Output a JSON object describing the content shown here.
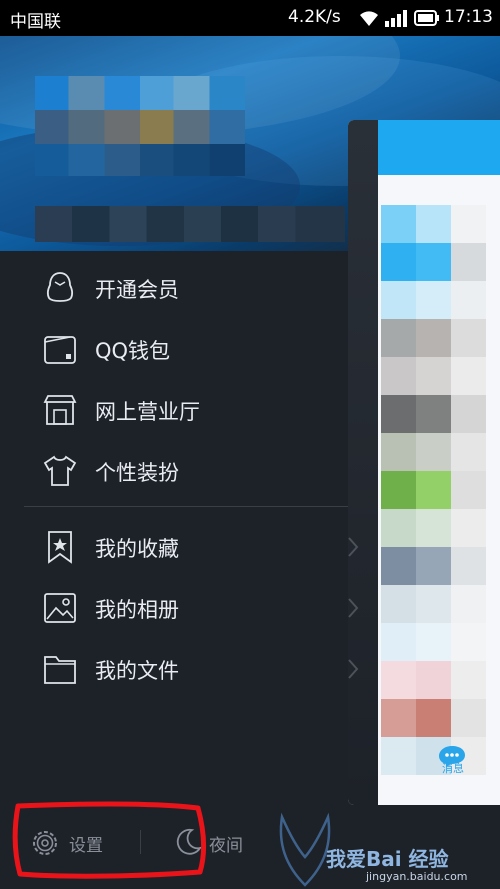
{
  "status_bar": {
    "carrier": "中国联",
    "net_speed": "4.2K/s",
    "time": "17:13"
  },
  "menu": [
    {
      "label": "开通会员",
      "icon": "penguin-icon"
    },
    {
      "label": "QQ钱包",
      "icon": "wallet-icon"
    },
    {
      "label": "网上营业厅",
      "icon": "store-icon"
    },
    {
      "label": "个性装扮",
      "icon": "tshirt-icon"
    },
    {
      "label": "我的收藏",
      "icon": "bookmark-star-icon"
    },
    {
      "label": "我的相册",
      "icon": "photo-album-icon"
    },
    {
      "label": "我的文件",
      "icon": "folder-icon"
    }
  ],
  "right_panel": {
    "tab_label": "消息"
  },
  "footer": {
    "settings_label": "设置",
    "night_label": "夜间"
  },
  "watermark": {
    "title": "我爱Bai 经验",
    "url": "jingyan.baidu.com"
  },
  "colors": {
    "accent": "#1ea8f0",
    "panel_bg": "#1d2128",
    "annotation": "#e8141a"
  }
}
